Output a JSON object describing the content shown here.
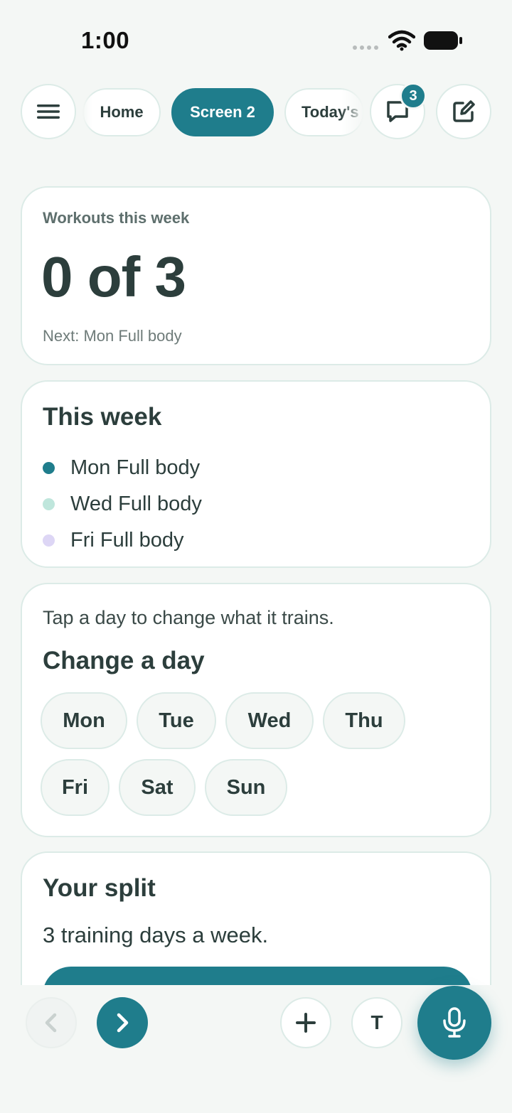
{
  "status_bar": {
    "time": "1:00"
  },
  "nav": {
    "menu_icon": "hamburger-menu-icon",
    "tabs": [
      {
        "label": "Home",
        "active": false
      },
      {
        "label": "Screen 2",
        "active": true
      },
      {
        "label": "Today's",
        "active": false
      }
    ],
    "messages_badge": "3",
    "messages_icon": "chat-bubble-icon",
    "edit_icon": "edit-square-icon"
  },
  "workouts_card": {
    "label": "Workouts this week",
    "value": "0 of 3",
    "next": "Next: Mon Full body"
  },
  "this_week": {
    "title": "This week",
    "items": [
      {
        "label": "Mon Full body",
        "color": "#1f7d8c"
      },
      {
        "label": "Wed Full body",
        "color": "#bfe6dc"
      },
      {
        "label": "Fri Full body",
        "color": "#ddd6f5"
      }
    ]
  },
  "change_day": {
    "hint": "Tap a day to change what it trains.",
    "title": "Change a day",
    "days": [
      "Mon",
      "Tue",
      "Wed",
      "Thu",
      "Fri",
      "Sat",
      "Sun"
    ]
  },
  "split": {
    "title": "Your split",
    "text": "3 training days a week.",
    "button_label": ""
  },
  "bottom_bar": {
    "back_icon": "chevron-left-icon",
    "forward_icon": "chevron-right-icon",
    "add_icon": "plus-icon",
    "text_button": "T",
    "mic_icon": "microphone-icon"
  },
  "colors": {
    "accent": "#1f7d8c",
    "background": "#f4f7f5",
    "border": "#dcebe7",
    "text": "#2c3e3c"
  }
}
